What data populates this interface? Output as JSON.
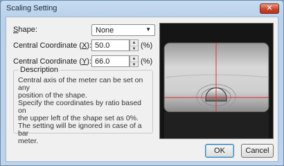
{
  "window": {
    "title": "Scaling Setting",
    "close_label": "✕"
  },
  "shape": {
    "label": "Shape:",
    "value": "None"
  },
  "coord_x": {
    "label_prefix": "Central Coordinate (",
    "label_key": "X",
    "label_suffix": "):",
    "value": "50.0",
    "unit": "(%)"
  },
  "coord_y": {
    "label_prefix": "Central Coordinate (",
    "label_key": "Y",
    "label_suffix": "):",
    "value": "66.0",
    "unit": "(%)"
  },
  "description": {
    "title": "Description",
    "lines": [
      "Central axis of the meter can be set on any",
      "position of the shape.",
      "Specify the coordinates by ratio based on",
      "the upper left of the shape set as 0%.",
      "The setting will be ignored in case of a bar",
      "meter."
    ]
  },
  "buttons": {
    "ok": "OK",
    "cancel": "Cancel"
  },
  "icons": {
    "close": "close-icon",
    "dropdown": "chevron-down-icon",
    "spin_up": "spin-up-icon",
    "spin_down": "spin-down-icon"
  },
  "colors": {
    "crosshair": "#e03030",
    "close_button": "#c9452c"
  }
}
